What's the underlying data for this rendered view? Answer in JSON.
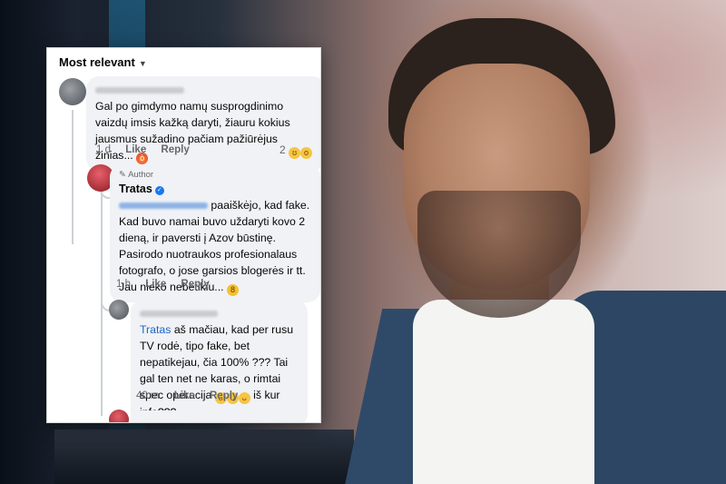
{
  "sort_label": "Most relevant",
  "comments": [
    {
      "text": "Gal po gimdymo namų susprogdinimo vaizdų imsis kažką daryti, žiauru kokius jausmus sužadino pačiam pažiūrėjus žinias...",
      "emoji": "angry-face",
      "time": "1 d",
      "like": "Like",
      "reply": "Reply",
      "reaction_count": "2"
    },
    {
      "badge": "Author",
      "name": "Tratas",
      "text": "paaiškėjo, kad fake. Kad buvo namai buvo uždaryti kovo 2 dieną, ir paversti į Azov būstinę. Pasirodo nuotraukos profesionalaus fotografo, o jose garsios blogerės ir tt. Jau nieko nebetikiu...",
      "emoji": "nerd-face",
      "time": "1 h",
      "like": "Like",
      "reply": "Reply"
    },
    {
      "mention": "Tratas",
      "text": "aš mačiau, kad per rusu TV rodė, tipo fake, bet nepatikejau, čia 100% ??? Tai gal ten net ne karas, o rimtai spec operacija",
      "text_tail": "iš kur info???",
      "time": "40 m",
      "like": "Like",
      "reply": "Reply"
    }
  ],
  "colors": {
    "mention": "#1b65c9",
    "bubble": "#f0f2f5",
    "meta": "#65676b",
    "verified": "#1877f2"
  }
}
